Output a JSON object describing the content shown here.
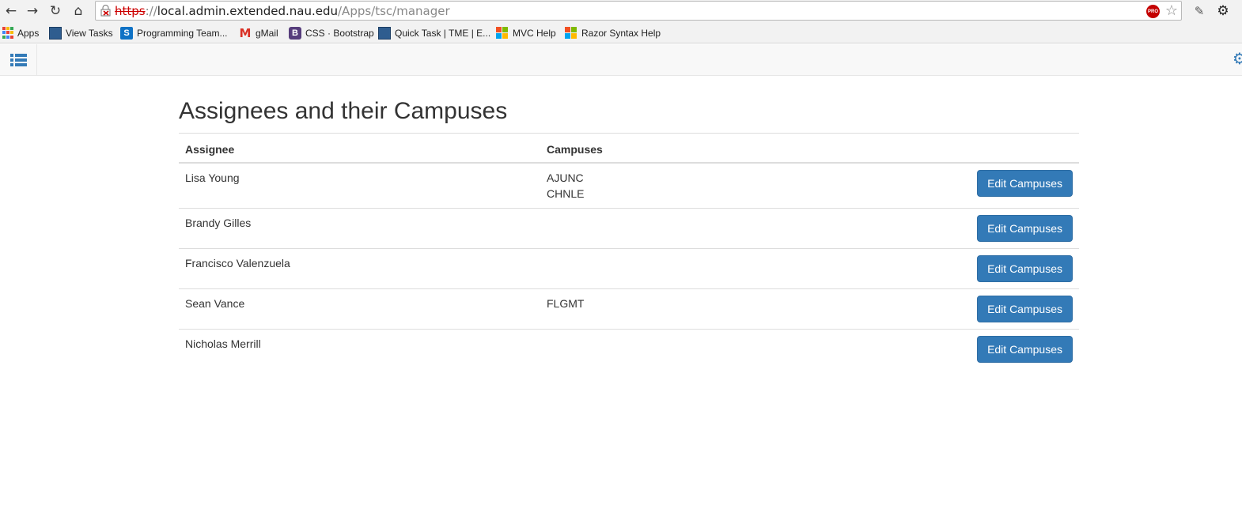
{
  "browser": {
    "url_scheme": "https",
    "url_separator": "://",
    "url_host": "local.admin.extended.nau.edu",
    "url_path": "/Apps/tsc/manager",
    "extension_badge": "PRO"
  },
  "bookmarks": [
    {
      "label": "Apps",
      "icon": "apps-grid-icon"
    },
    {
      "label": "View Tasks",
      "icon": "tme-icon"
    },
    {
      "label": "Programming Team...",
      "icon": "sharepoint-icon"
    },
    {
      "label": "gMail",
      "icon": "gmail-icon"
    },
    {
      "label": "CSS · Bootstrap",
      "icon": "bootstrap-icon"
    },
    {
      "label": "Quick Task | TME | E...",
      "icon": "tme-icon"
    },
    {
      "label": "MVC Help",
      "icon": "microsoft-icon"
    },
    {
      "label": "Razor Syntax Help",
      "icon": "microsoft-icon"
    }
  ],
  "page": {
    "title": "Assignees and their Campuses",
    "table": {
      "headers": [
        "Assignee",
        "Campuses",
        ""
      ],
      "rows": [
        {
          "assignee": "Lisa Young",
          "campuses": [
            "AJUNC",
            "CHNLE"
          ],
          "action": "Edit Campuses"
        },
        {
          "assignee": "Brandy Gilles",
          "campuses": [],
          "action": "Edit Campuses"
        },
        {
          "assignee": "Francisco Valenzuela",
          "campuses": [],
          "action": "Edit Campuses"
        },
        {
          "assignee": "Sean Vance",
          "campuses": [
            "FLGMT"
          ],
          "action": "Edit Campuses"
        },
        {
          "assignee": "Nicholas Merrill",
          "campuses": [],
          "action": "Edit Campuses"
        }
      ]
    }
  },
  "colors": {
    "primary": "#337ab7",
    "navbar_bg": "#f8f8f8",
    "border": "#dddddd"
  }
}
